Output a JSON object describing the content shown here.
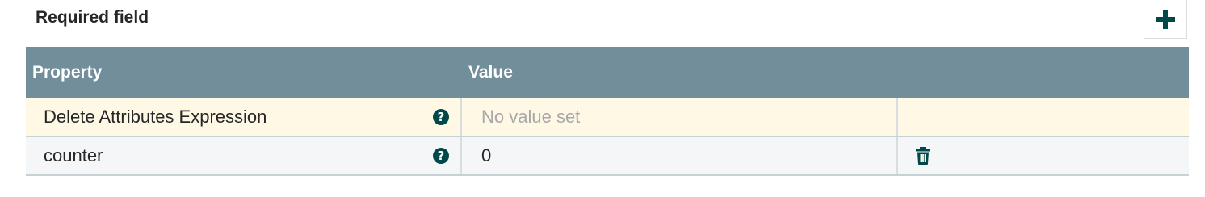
{
  "header": {
    "title": "Required field",
    "add_icon": "plus-icon"
  },
  "table": {
    "columns": [
      "Property",
      "Value"
    ],
    "rows": [
      {
        "name": "Delete Attributes Expression",
        "value": "No value set",
        "value_is_placeholder": true,
        "help_icon": "question-circle-icon",
        "deletable": false
      },
      {
        "name": "counter",
        "value": "0",
        "value_is_placeholder": false,
        "help_icon": "question-circle-icon",
        "deletable": true,
        "delete_icon": "trash-icon"
      }
    ]
  },
  "colors": {
    "header_bg": "#728e9b",
    "highlight_row_bg": "#fef8e5",
    "normal_row_bg": "#f4f6f7",
    "icon_color": "#004849",
    "placeholder_text": "#a8a8a8"
  }
}
